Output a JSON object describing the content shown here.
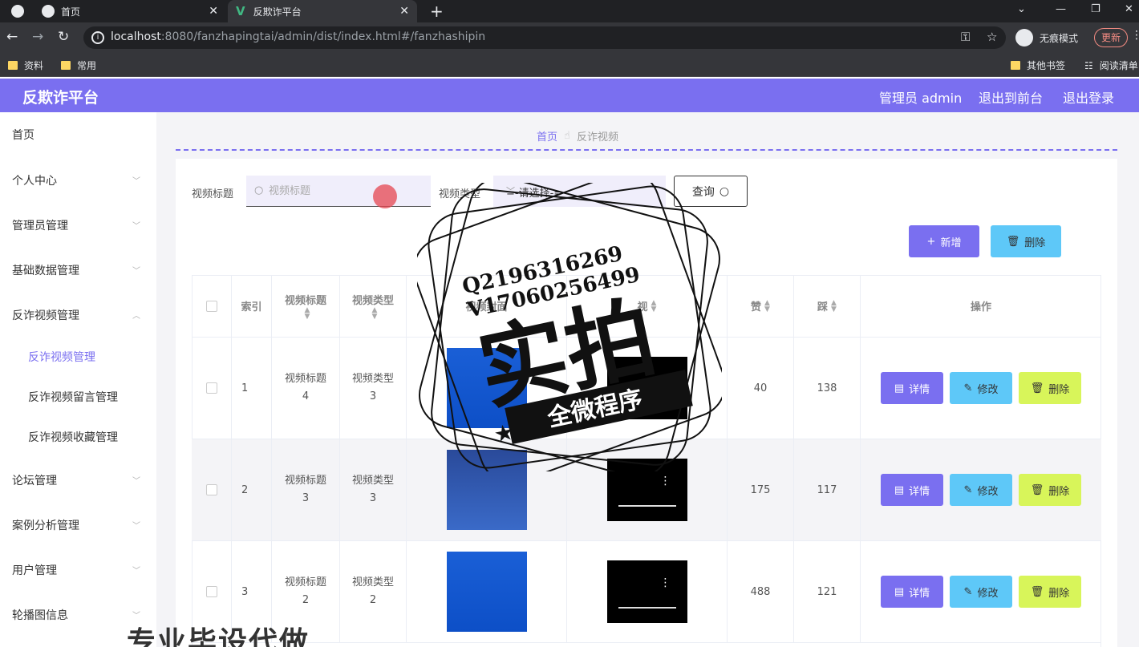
{
  "browser": {
    "tabs": [
      {
        "title": "首页"
      },
      {
        "title": "反欺诈平台"
      }
    ],
    "url_host": "localhost",
    "url_rest": ":8080/fanzhapingtai/admin/dist/index.html#/fanzhashipin",
    "incognito_label": "无痕模式",
    "update_label": "更新",
    "bookmarks": [
      "资料",
      "常用"
    ],
    "bookmarks_right": [
      "其他书签",
      "阅读清单"
    ]
  },
  "header": {
    "title": "反欺诈平台",
    "admin_label": "管理员 admin",
    "exit_front": "退出到前台",
    "logout": "退出登录"
  },
  "sidebar": {
    "items": [
      {
        "label": "首页"
      },
      {
        "label": "个人中心"
      },
      {
        "label": "管理员管理"
      },
      {
        "label": "基础数据管理"
      },
      {
        "label": "反诈视频管理"
      },
      {
        "label": "论坛管理"
      },
      {
        "label": "案例分析管理"
      },
      {
        "label": "用户管理"
      },
      {
        "label": "轮播图信息"
      }
    ],
    "sub_items": [
      {
        "label": "反诈视频管理"
      },
      {
        "label": "反诈视频留言管理"
      },
      {
        "label": "反诈视频收藏管理"
      }
    ]
  },
  "breadcrumb": {
    "home": "首页",
    "current": "反诈视频"
  },
  "filters": {
    "title_label": "视频标题",
    "title_placeholder": "视频标题",
    "type_label": "视频类型",
    "type_value": "=-请选择-=",
    "query_label": "查询"
  },
  "actions": {
    "add_label": "新增",
    "delete_label": "删除"
  },
  "table": {
    "headers": {
      "index": "索引",
      "title": "视频标题",
      "type": "视频类型",
      "cover": "视频封面",
      "video": "视",
      "like": "赞",
      "dislike": "踩",
      "ops": "操作"
    },
    "rows": [
      {
        "index": "1",
        "title": "视频标题4",
        "type": "视频类型3",
        "like": "40",
        "dislike": "138"
      },
      {
        "index": "2",
        "title": "视频标题3",
        "type": "视频类型3",
        "like": "175",
        "dislike": "117"
      },
      {
        "index": "3",
        "title": "视频标题2",
        "type": "视频类型2",
        "like": "488",
        "dislike": "121"
      }
    ],
    "op_labels": {
      "detail": "详情",
      "edit": "修改",
      "delete": "删除"
    }
  },
  "watermark": {
    "qq": "Q2196316269",
    "vx": "V17060256499",
    "big": "实拍",
    "band": "全微程序",
    "bottom": "专业毕设代做"
  }
}
